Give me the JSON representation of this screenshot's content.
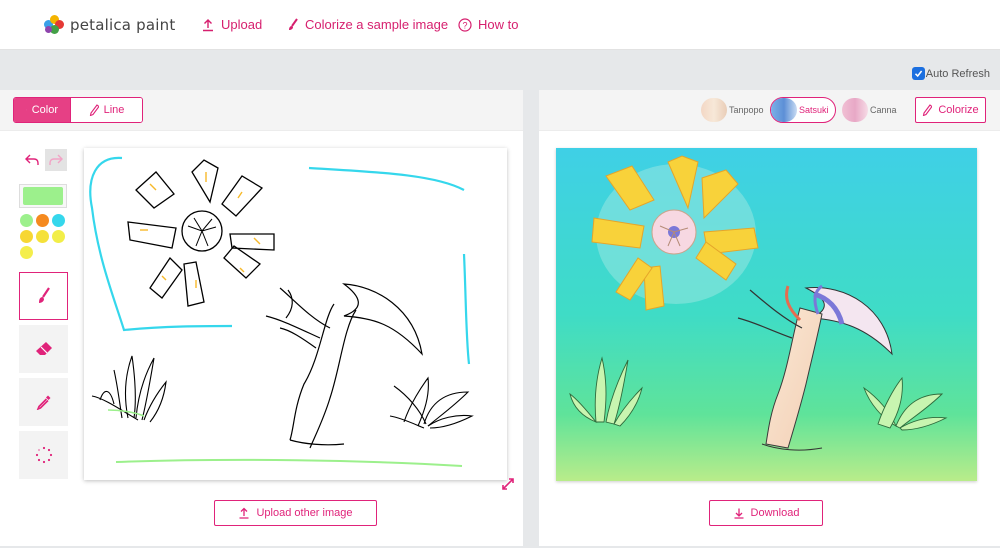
{
  "brand": {
    "name": "petalica paint"
  },
  "nav": {
    "upload": "Upload",
    "sample": "Colorize a sample image",
    "howto": "How to"
  },
  "auto_refresh": {
    "label": "Auto Refresh",
    "checked": true
  },
  "left_panel": {
    "modes": {
      "color": "Color",
      "line": "Line"
    },
    "active_mode": "Color",
    "current_color": "#9cf08c",
    "palette": [
      "#9cf08c",
      "#f58a1f",
      "#35d7ec",
      "#f7d733",
      "#f5e13a",
      "#f2ee48",
      "#f4ee4c"
    ],
    "tools": [
      "pen",
      "eraser",
      "eyedropper",
      "loading"
    ],
    "active_tool": "pen",
    "upload_other": "Upload other image"
  },
  "right_panel": {
    "styles": [
      {
        "name": "Tanpopo",
        "selected": false
      },
      {
        "name": "Satsuki",
        "selected": true
      },
      {
        "name": "Canna",
        "selected": false
      }
    ],
    "colorize": "Colorize",
    "download": "Download"
  },
  "colors": {
    "accent": "#e0237a",
    "accent_fill": "#e64085",
    "checkbox": "#1b6fe0"
  }
}
